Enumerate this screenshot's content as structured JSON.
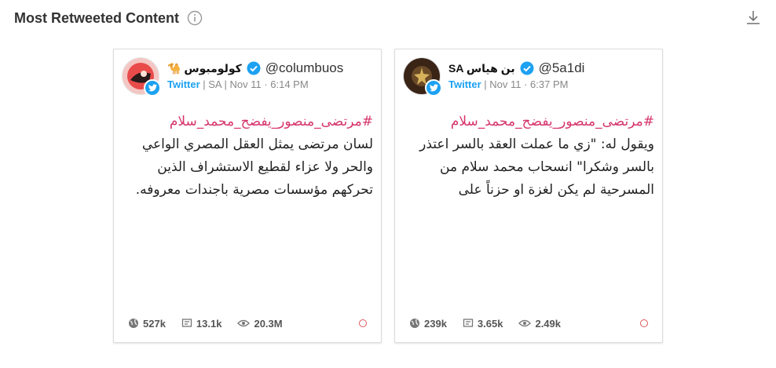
{
  "header": {
    "title": "Most Retweeted Content"
  },
  "colors": {
    "hashtag": "#d6336c",
    "twitter": "#1da1f2",
    "stat_dot": "#e0565a"
  },
  "cards": [
    {
      "display_name": "كولومبوس 🐪",
      "handle": "@columbuos",
      "source": "Twitter",
      "meta": " | SA | Nov 11 · 6:14 PM",
      "hashtag": "#مرتضى_منصور_يفضح_محمد_سلام",
      "lines": [
        "لسان مرتضى يمثل العقل المصري الواعي",
        "والحر ولا عزاء لقطيع الاستشراف الذين",
        "تحركهم مؤسسات مصرية باجندات معروفه."
      ],
      "stats": {
        "retweets": "527k",
        "replies": "13.1k",
        "views": "20.3M"
      }
    },
    {
      "display_name": "SA بن هياس",
      "handle": "@5a1di",
      "source": "Twitter",
      "meta": " | Nov 11 · 6:37 PM",
      "hashtag": "#مرتضى_منصور_يفضح_محمد_سلام",
      "lines": [
        "ويقول له: \"زي ما عملت العقد بالسر اعتذر",
        "بالسر وشكرا\" انسحاب محمد سلام من",
        "المسرحية لم يكن لغزة او حزناً على"
      ],
      "stats": {
        "retweets": "239k",
        "replies": "3.65k",
        "views": "2.49k"
      }
    }
  ]
}
